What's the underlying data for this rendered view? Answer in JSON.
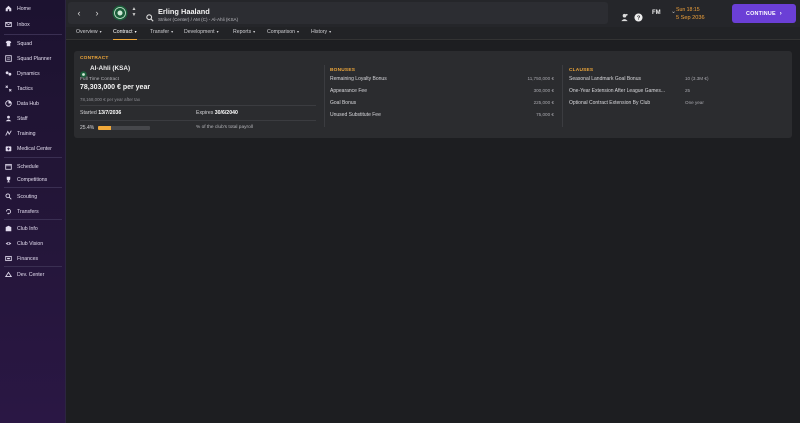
{
  "sidebar": {
    "items": [
      {
        "label": "Home",
        "icon": "home-icon"
      },
      {
        "label": "Inbox",
        "icon": "inbox-icon"
      },
      {
        "label": "Squad",
        "icon": "squad-icon"
      },
      {
        "label": "Squad Planner",
        "icon": "squad-planner-icon"
      },
      {
        "label": "Dynamics",
        "icon": "dynamics-icon"
      },
      {
        "label": "Tactics",
        "icon": "tactics-icon"
      },
      {
        "label": "Data Hub",
        "icon": "data-hub-icon"
      },
      {
        "label": "Staff",
        "icon": "staff-icon"
      },
      {
        "label": "Training",
        "icon": "training-icon"
      },
      {
        "label": "Medical Center",
        "icon": "medical-icon"
      },
      {
        "label": "Schedule",
        "icon": "schedule-icon"
      },
      {
        "label": "Competitions",
        "icon": "trophy-icon"
      },
      {
        "label": "Scouting",
        "icon": "scouting-icon"
      },
      {
        "label": "Transfers",
        "icon": "transfers-icon"
      },
      {
        "label": "Club Info",
        "icon": "club-info-icon"
      },
      {
        "label": "Club Vision",
        "icon": "club-vision-icon"
      },
      {
        "label": "Finances",
        "icon": "finances-icon"
      },
      {
        "label": "Dev. Center",
        "icon": "dev-center-icon"
      }
    ]
  },
  "header": {
    "player_name": "Erling Haaland",
    "player_subtitle": "Striker (Center) / AM (C) - Al-Ahli (KSA)",
    "fm_label": "FM",
    "time": "Sun 18:15",
    "date": "5 Sep 2036",
    "continue_label": "CONTINUE",
    "accent_color": "#6b3fd6"
  },
  "tabs": [
    {
      "label": "Overview"
    },
    {
      "label": "Contract"
    },
    {
      "label": "Transfer"
    },
    {
      "label": "Development"
    },
    {
      "label": "Reports"
    },
    {
      "label": "Comparison"
    },
    {
      "label": "History"
    }
  ],
  "contract": {
    "heading": "CONTRACT",
    "club": "Al-Ahli (KSA)",
    "type": "Full Time Contract",
    "salary": "78,303,000 € per year",
    "salary_after_tax": "78,168,000 € per year after tax",
    "started_label": "Started",
    "started_value": "13/7/2036",
    "expires_label": "Expires",
    "expires_value": "30/6/2040",
    "payroll_pct": "25.4%",
    "payroll_fraction": 0.254,
    "payroll_label": "% of the club's total payroll"
  },
  "bonuses": {
    "heading": "BONUSES",
    "rows": [
      {
        "label": "Remaining Loyalty Bonus",
        "value": "11,750,000 €"
      },
      {
        "label": "Appearance Fee",
        "value": "300,000 €"
      },
      {
        "label": "Goal Bonus",
        "value": "225,000 €"
      },
      {
        "label": "Unused Substitute Fee",
        "value": "75,000 €"
      }
    ]
  },
  "clauses": {
    "heading": "CLAUSES",
    "rows": [
      {
        "label": "Seasonal Landmark Goal Bonus",
        "value": "10 (3.3M €)"
      },
      {
        "label": "One-Year Extension After League Games...",
        "value": "25"
      },
      {
        "label": "Optional Contract Extension By Club",
        "value": "One year"
      }
    ]
  }
}
